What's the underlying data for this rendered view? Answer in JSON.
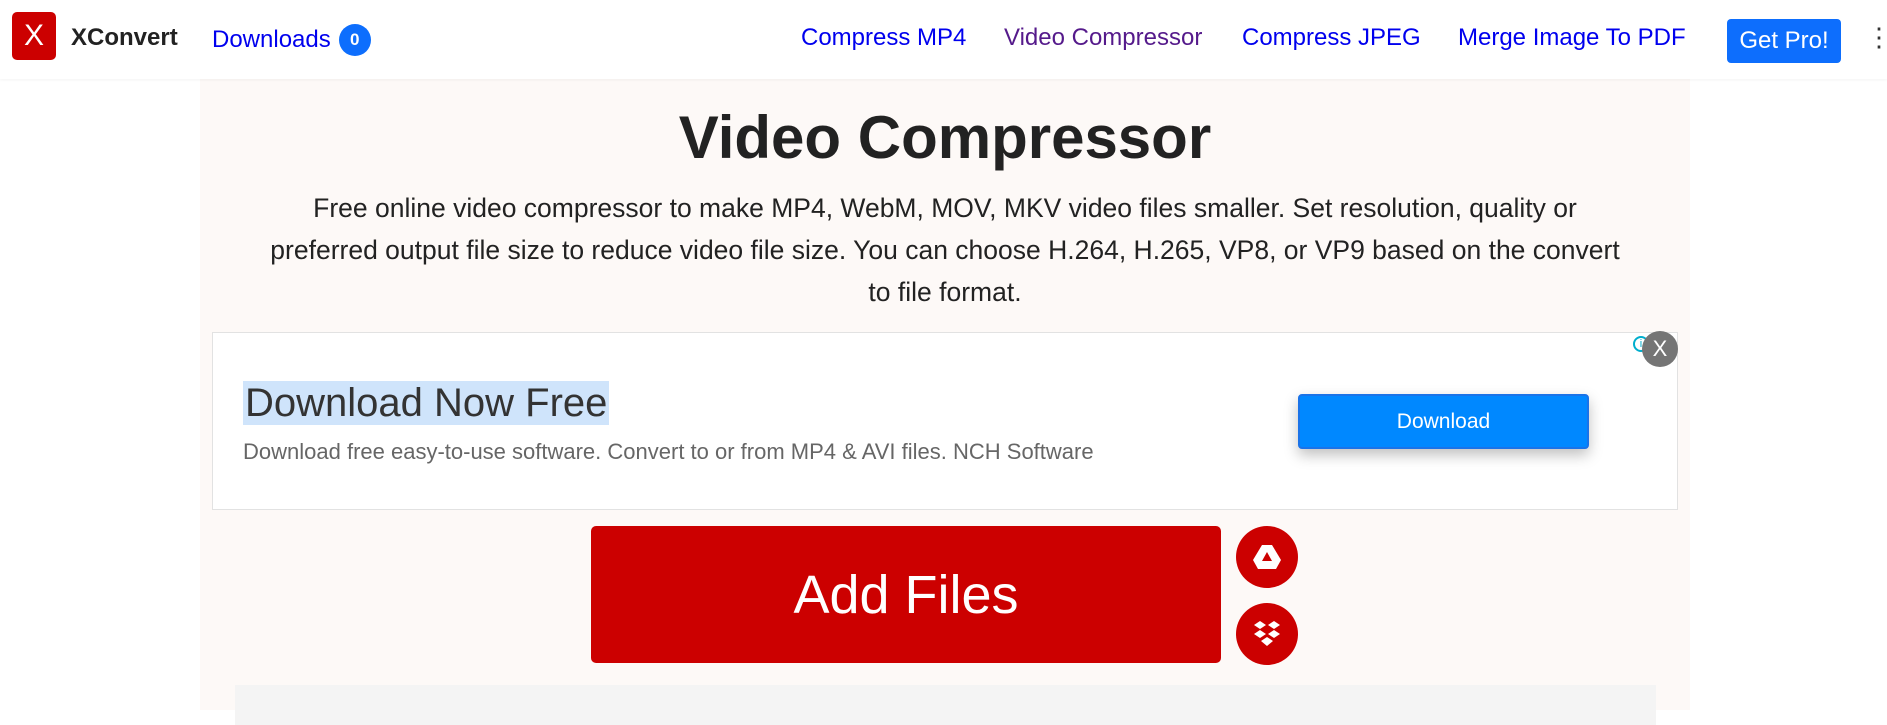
{
  "nav": {
    "logo_letter": "X",
    "brand": "XConvert",
    "downloads_label": "Downloads",
    "downloads_count": "0",
    "links": [
      "Compress MP4",
      "Video Compressor",
      "Compress JPEG",
      "Merge Image To PDF"
    ],
    "get_pro": "Get Pro!",
    "more_icon": "⋮"
  },
  "main": {
    "title": "Video Compressor",
    "description": "Free online video compressor to make MP4, WebM, MOV, MKV video files smaller. Set resolution, quality or preferred output file size to reduce video file size. You can choose H.264, H.265, VP8, or VP9 based on the convert to file format.",
    "add_files": "Add Files"
  },
  "ad": {
    "heading": "Download Now Free",
    "subtext": "Download free easy-to-use software. Convert to or from MP4 & AVI files. NCH Software",
    "button": "Download",
    "close": "X",
    "info": "i"
  },
  "colors": {
    "brand_red": "#cc0000",
    "link_blue": "#0000ee",
    "visited": "#551a8b",
    "primary": "#0d6efd",
    "ad_button": "#0088ff"
  }
}
